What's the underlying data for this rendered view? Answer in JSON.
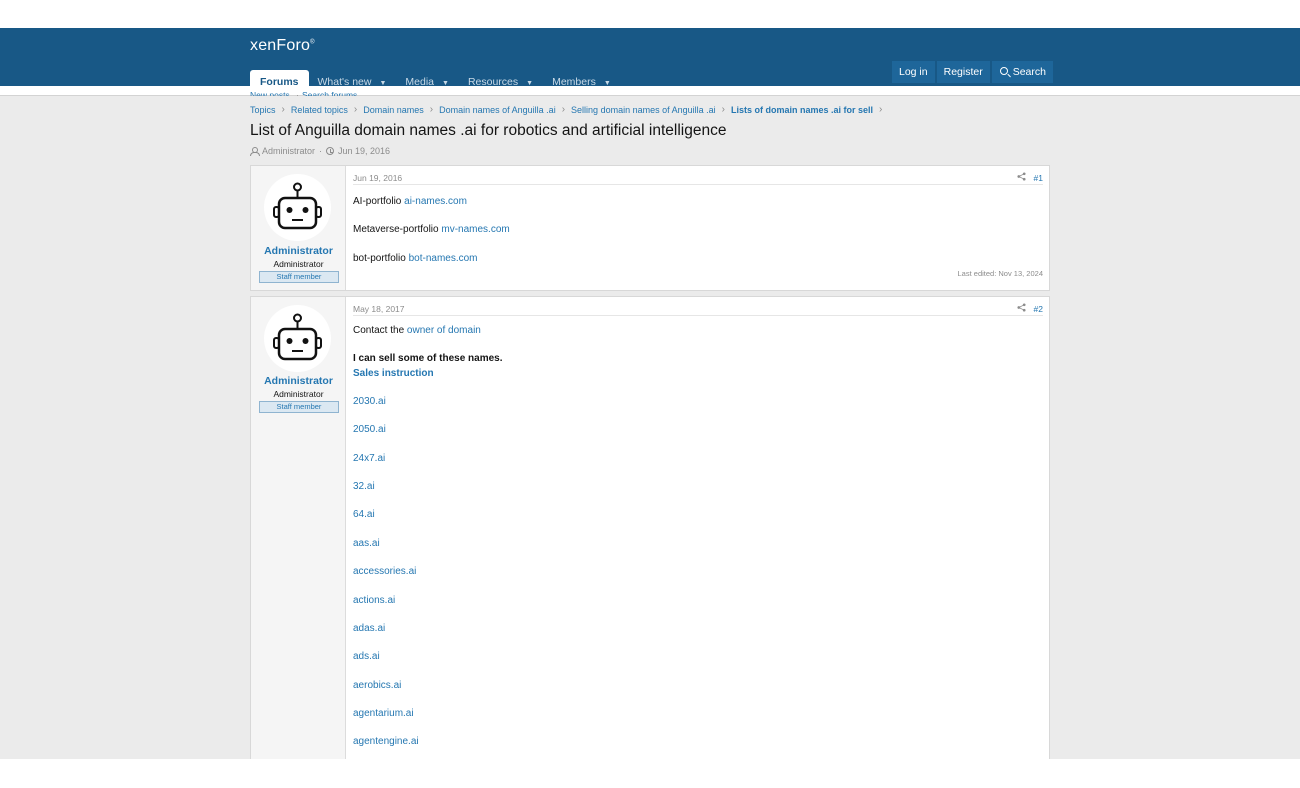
{
  "header": {
    "logo": "xenForo",
    "nav": [
      {
        "label": "Forums",
        "active": true,
        "has_caret": false
      },
      {
        "label": "What's new",
        "active": false,
        "has_caret": true
      },
      {
        "label": "Media",
        "active": false,
        "has_caret": true
      },
      {
        "label": "Resources",
        "active": false,
        "has_caret": true
      },
      {
        "label": "Members",
        "active": false,
        "has_caret": true
      }
    ],
    "subnav": [
      "New posts",
      "Search forums"
    ],
    "login": "Log in",
    "register": "Register",
    "search": "Search"
  },
  "breadcrumbs": [
    "Topics",
    "Related topics",
    "Domain names",
    "Domain names of Anguilla .ai",
    "Selling domain names of Anguilla .ai",
    "Lists of domain names .ai for sell"
  ],
  "thread": {
    "title": "List of Anguilla domain names .ai for robotics and artificial intelligence",
    "author": "Administrator",
    "date": "Jun 19, 2016"
  },
  "posts": [
    {
      "user": {
        "name": "Administrator",
        "title": "Administrator",
        "banner": "Staff member"
      },
      "date": "Jun 19, 2016",
      "number": "#1",
      "edited": "Last edited: Nov 13, 2024",
      "lines": [
        {
          "text": "AI-portfolio ",
          "link": "ai-names.com"
        },
        {
          "text": "",
          "link": ""
        },
        {
          "text": "Metaverse-portfolio ",
          "link": "mv-names.com"
        },
        {
          "text": "",
          "link": ""
        },
        {
          "text": "bot-portfolio ",
          "link": "bot-names.com"
        }
      ]
    },
    {
      "user": {
        "name": "Administrator",
        "title": "Administrator",
        "banner": "Staff member"
      },
      "date": "May 18, 2017",
      "number": "#2",
      "intro_text": "Contact the ",
      "intro_link": "owner of domain",
      "bold_text": "I can sell some of these names.",
      "sales_link": "Sales instruction",
      "domains": [
        "2030.ai",
        "2050.ai",
        "24x7.ai",
        "32.ai",
        "64.ai",
        "aas.ai",
        "accessories.ai",
        "actions.ai",
        "adas.ai",
        "ads.ai",
        "aerobics.ai",
        "agentarium.ai",
        "agentengine.ai"
      ]
    }
  ],
  "colors": {
    "header_bg": "#185886",
    "link": "#2577b1",
    "page_bg": "#ebebeb"
  }
}
